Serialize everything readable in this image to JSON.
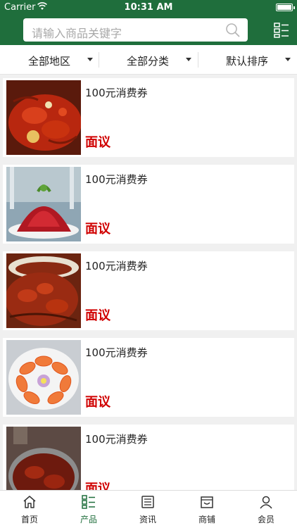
{
  "status_bar": {
    "carrier": "Carrier",
    "time": "10:31 AM",
    "battery_level": 1.0
  },
  "search": {
    "placeholder": "请输入商品关键字"
  },
  "filters": [
    {
      "label": "全部地区"
    },
    {
      "label": "全部分类"
    },
    {
      "label": "默认排序"
    }
  ],
  "products": [
    {
      "title": "100元消费券",
      "price": "面议"
    },
    {
      "title": "100元消费券",
      "price": "面议"
    },
    {
      "title": "100元消费券",
      "price": "面议"
    },
    {
      "title": "100元消费券",
      "price": "面议"
    },
    {
      "title": "100元消费券",
      "price": "面议"
    }
  ],
  "tabs": [
    {
      "label": "首页",
      "icon": "home-icon"
    },
    {
      "label": "产品",
      "icon": "product-list-icon",
      "active": true
    },
    {
      "label": "资讯",
      "icon": "news-icon"
    },
    {
      "label": "商铺",
      "icon": "store-icon"
    },
    {
      "label": "会员",
      "icon": "member-icon"
    }
  ],
  "colors": {
    "brand": "#1f6e3c",
    "price": "#d00000"
  }
}
